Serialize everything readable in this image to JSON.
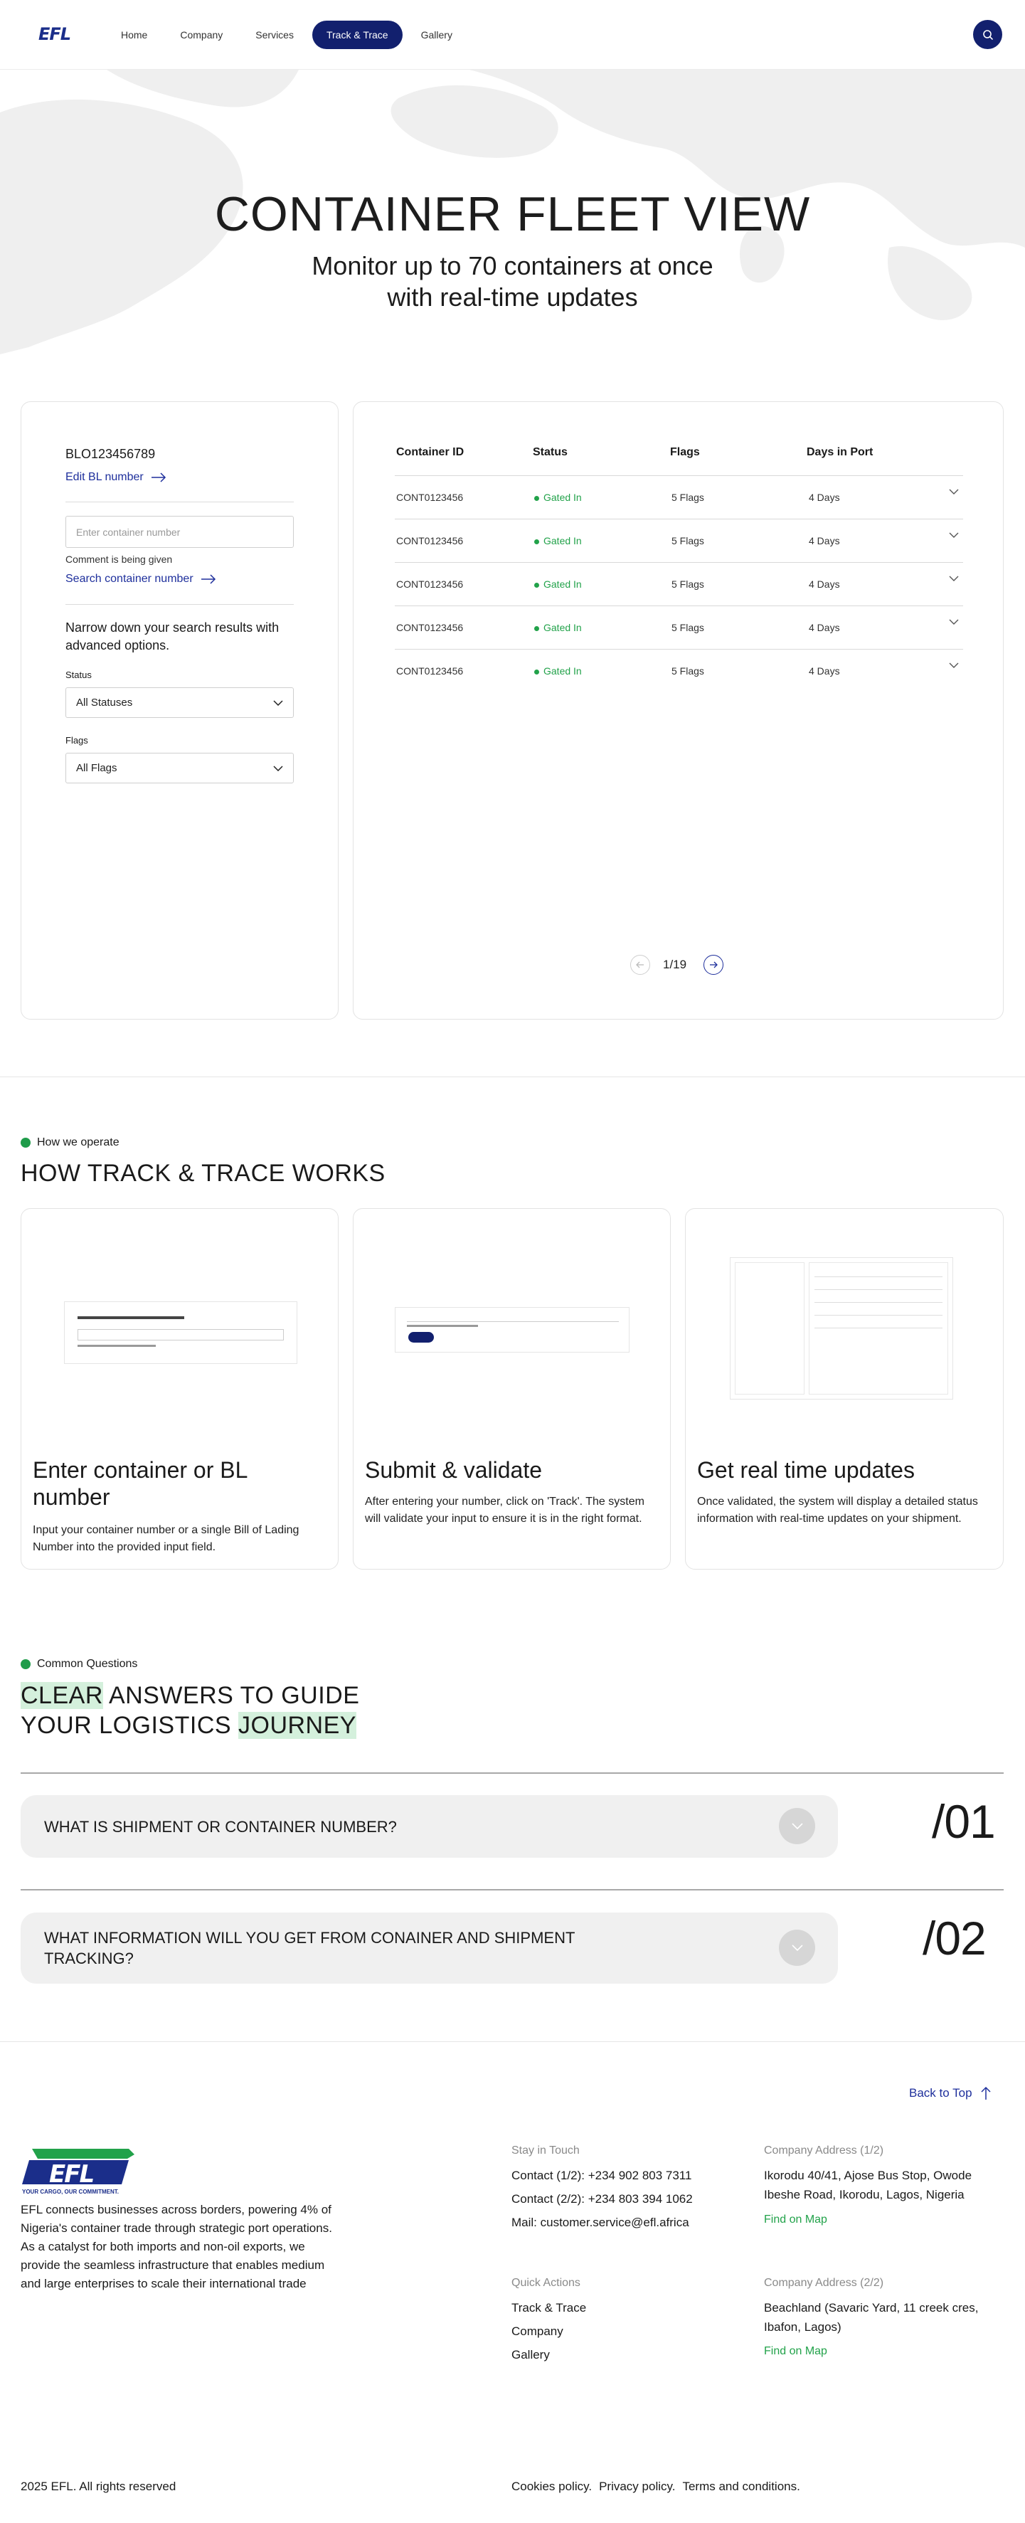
{
  "nav": {
    "logo": "EFL",
    "items": [
      "Home",
      "Company",
      "Services",
      "Track & Trace",
      "Gallery"
    ],
    "active_index": 3,
    "search_icon": "search-icon"
  },
  "hero": {
    "title": "CONTAINER FLEET VIEW",
    "subtitle": "Monitor up to 70 containers at once with real-time updates"
  },
  "sidebar": {
    "bl_number": "BLO123456789",
    "edit_bl_link": "Edit BL number",
    "container_placeholder": "Enter container number",
    "comment": "Comment is being given",
    "search_link": "Search container number",
    "narrow_text": "Narrow down your search results with advanced options.",
    "status_label": "Status",
    "status_value": "All Statuses",
    "flags_label": "Flags",
    "flags_value": "All Flags"
  },
  "table": {
    "headers": [
      "Container ID",
      "Status",
      "Flags",
      "Days in Port"
    ],
    "rows": [
      {
        "id": "CONT0123456",
        "status": "Gated In",
        "flags": "5 Flags",
        "days": "4 Days"
      },
      {
        "id": "CONT0123456",
        "status": "Gated In",
        "flags": "5 Flags",
        "days": "4 Days"
      },
      {
        "id": "CONT0123456",
        "status": "Gated In",
        "flags": "5 Flags",
        "days": "4 Days"
      },
      {
        "id": "CONT0123456",
        "status": "Gated In",
        "flags": "5 Flags",
        "days": "4 Days"
      },
      {
        "id": "CONT0123456",
        "status": "Gated In",
        "flags": "5 Flags",
        "days": "4 Days"
      }
    ],
    "status_color": "#22a24a",
    "pagination": "1/19"
  },
  "how": {
    "label": "How we operate",
    "title": "HOW TRACK & TRACE WORKS",
    "steps": [
      {
        "title": "Enter container or BL number",
        "desc": "Input your container number or a single Bill of Lading Number into the provided input field."
      },
      {
        "title": "Submit & validate",
        "desc": "After entering your number, click on 'Track'. The system will validate your input to ensure it is in the right format."
      },
      {
        "title": "Get real time updates",
        "desc": "Once validated, the system will display a detailed status information with real-time updates on your shipment."
      }
    ]
  },
  "faq": {
    "label": "Common Questions",
    "title_hl1": "CLEAR",
    "title_part1": " ANSWERS TO GUIDE",
    "title_part2": "YOUR LOGISTICS ",
    "title_hl2": "JOURNEY",
    "items": [
      {
        "question": "WHAT IS SHIPMENT OR CONTAINER NUMBER?",
        "num": "/01"
      },
      {
        "question": "WHAT INFORMATION WILL YOU GET FROM CONAINER AND SHIPMENT TRACKING?",
        "num": "/02"
      }
    ]
  },
  "footer": {
    "back_to_top": "Back to Top",
    "logo": "EFL",
    "tagline": "YOUR CARGO, OUR COMMITMENT.",
    "about": "EFL connects businesses across borders, powering 4% of Nigeria's container trade through strategic port operations. As a catalyst for both imports and non-oil exports, we provide the seamless infrastructure that enables medium and large enterprises to scale their international trade",
    "stay_head": "Stay in Touch",
    "contact1": "Contact (1/2): +234 902 803 7311",
    "contact2": "Contact (2/2): +234 803 394 1062",
    "mail": "Mail: customer.service@efl.africa",
    "quick_head": "Quick Actions",
    "quick_links": [
      "Track & Trace",
      "Company",
      "Gallery"
    ],
    "addr1_head": "Company Address (1/2)",
    "addr1": "Ikorodu 40/41, Ajose Bus Stop, Owode Ibeshe Road, Ikorodu, Lagos, Nigeria",
    "addr2_head": "Company Address (2/2)",
    "addr2": "Beachland (Savaric Yard, 11 creek cres, Ibafon, Lagos)",
    "find_on_map": "Find on Map",
    "copyright": "2025 EFL. All rights reserved",
    "policies": [
      "Cookies policy.",
      "Privacy policy.",
      "Terms and conditions."
    ]
  }
}
